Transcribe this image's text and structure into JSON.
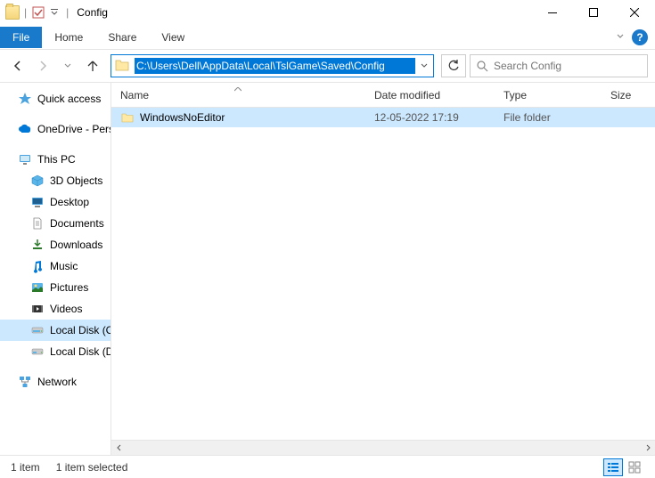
{
  "window": {
    "title": "Config"
  },
  "ribbon": {
    "file": "File",
    "tabs": [
      "Home",
      "Share",
      "View"
    ]
  },
  "address": {
    "path": "C:\\Users\\Dell\\AppData\\Local\\TslGame\\Saved\\Config"
  },
  "search": {
    "placeholder": "Search Config"
  },
  "sidebar": {
    "quickaccess": "Quick access",
    "onedrive": "OneDrive - Persona",
    "thispc": "This PC",
    "items": [
      "3D Objects",
      "Desktop",
      "Documents",
      "Downloads",
      "Music",
      "Pictures",
      "Videos",
      "Local Disk (C:)",
      "Local Disk (D:)"
    ],
    "network": "Network"
  },
  "columns": {
    "name": "Name",
    "date": "Date modified",
    "type": "Type",
    "size": "Size"
  },
  "files": [
    {
      "name": "WindowsNoEditor",
      "date": "12-05-2022 17:19",
      "type": "File folder",
      "size": ""
    }
  ],
  "status": {
    "count": "1 item",
    "selected": "1 item selected"
  }
}
